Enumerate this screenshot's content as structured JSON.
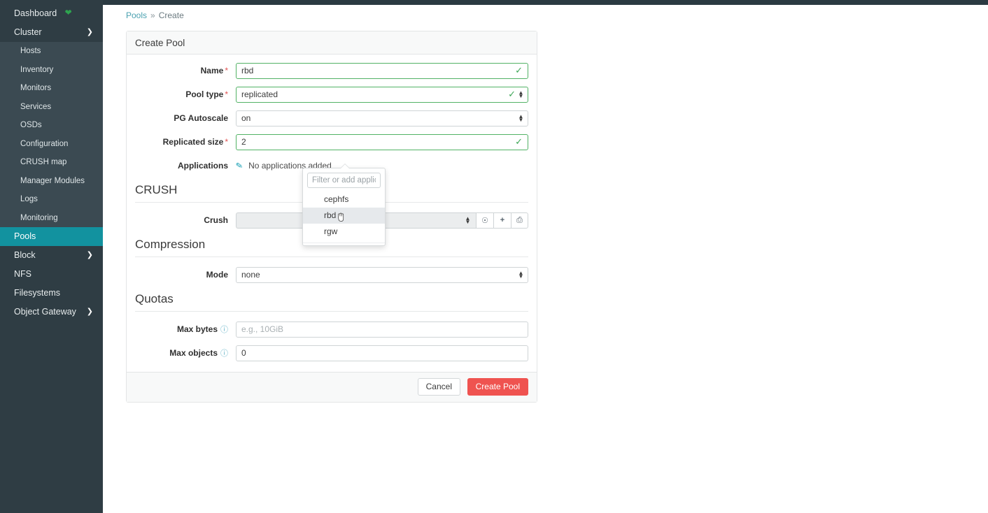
{
  "sidebar": {
    "items": [
      {
        "label": "Dashboard",
        "type": "top",
        "icon": "heart-icon",
        "icon_color": "#2ea44f"
      },
      {
        "label": "Cluster",
        "type": "top",
        "icon": "chevron-down-icon",
        "expanded": true
      },
      {
        "label": "Hosts",
        "type": "sub"
      },
      {
        "label": "Inventory",
        "type": "sub"
      },
      {
        "label": "Monitors",
        "type": "sub"
      },
      {
        "label": "Services",
        "type": "sub"
      },
      {
        "label": "OSDs",
        "type": "sub"
      },
      {
        "label": "Configuration",
        "type": "sub"
      },
      {
        "label": "CRUSH map",
        "type": "sub"
      },
      {
        "label": "Manager Modules",
        "type": "sub"
      },
      {
        "label": "Logs",
        "type": "sub"
      },
      {
        "label": "Monitoring",
        "type": "sub"
      },
      {
        "label": "Pools",
        "type": "top",
        "active": true
      },
      {
        "label": "Block",
        "type": "top",
        "icon": "chevron-right-icon"
      },
      {
        "label": "NFS",
        "type": "top"
      },
      {
        "label": "Filesystems",
        "type": "top"
      },
      {
        "label": "Object Gateway",
        "type": "top",
        "icon": "chevron-right-icon"
      }
    ],
    "active_color": "#12929f",
    "background": "#2f3d44",
    "submenu_background": "#3b4a52"
  },
  "breadcrumb": {
    "root": "Pools",
    "separator": "»",
    "current": "Create"
  },
  "card": {
    "title": "Create Pool",
    "fields": {
      "name": {
        "label": "Name",
        "required": true,
        "value": "rbd",
        "state": "valid"
      },
      "pool_type": {
        "label": "Pool type",
        "required": true,
        "value": "replicated",
        "state": "valid"
      },
      "pg_autoscale": {
        "label": "PG Autoscale",
        "required": false,
        "value": "on",
        "state": "normal"
      },
      "replicated_size": {
        "label": "Replicated size",
        "required": true,
        "value": "2",
        "state": "valid"
      },
      "applications": {
        "label": "Applications",
        "required": false,
        "value": "No applications added",
        "edit_icon": "pencil-icon"
      }
    },
    "sections": {
      "crush": {
        "title": "CRUSH",
        "row_label": "Crush",
        "select_value": "",
        "disabled": true,
        "buttons": [
          {
            "name": "help-icon",
            "glyph": "?"
          },
          {
            "name": "add-icon",
            "glyph": "+"
          },
          {
            "name": "trash-icon",
            "glyph": "🗑"
          }
        ]
      },
      "compression": {
        "title": "Compression",
        "mode_label": "Mode",
        "mode_value": "none"
      },
      "quotas": {
        "title": "Quotas",
        "max_bytes_label": "Max bytes",
        "max_bytes_value": "",
        "max_bytes_placeholder": "e.g., 10GiB",
        "max_objects_label": "Max objects",
        "max_objects_value": "0"
      }
    },
    "footer": {
      "cancel_label": "Cancel",
      "submit_label": "Create Pool",
      "submit_color": "#ef5350"
    }
  },
  "applications_dropdown": {
    "filter_placeholder": "Filter or add application",
    "filter_value": "",
    "options": [
      {
        "label": "cephfs",
        "hover": false
      },
      {
        "label": "rbd",
        "hover": true
      },
      {
        "label": "rgw",
        "hover": false
      }
    ]
  }
}
